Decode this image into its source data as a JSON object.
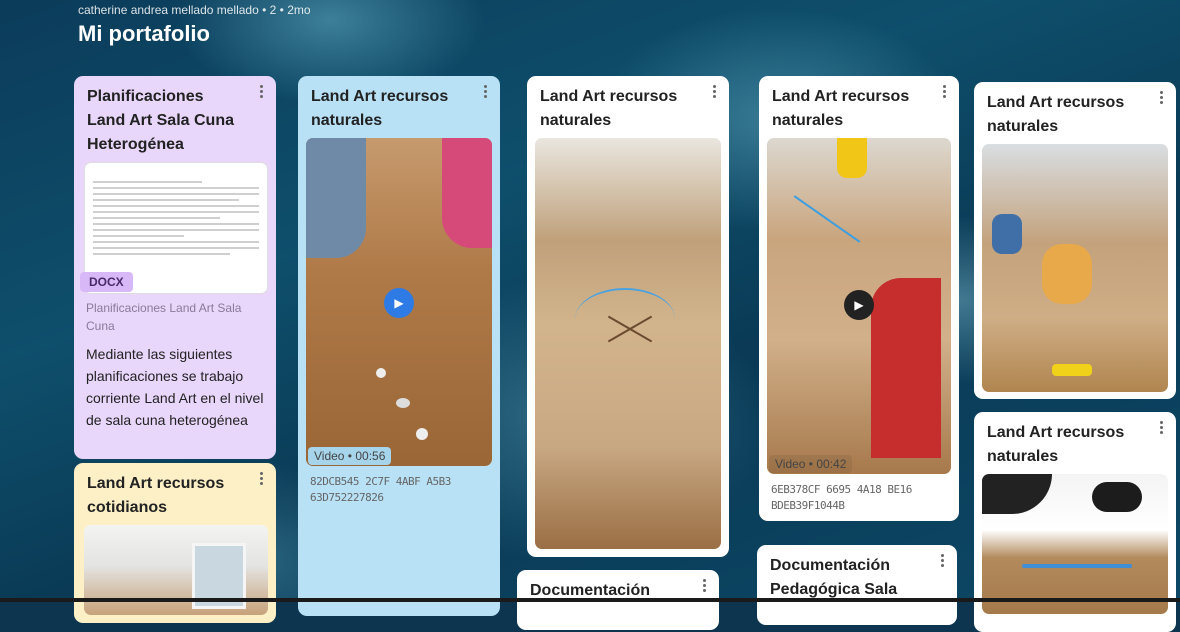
{
  "board": {
    "author_meta": "catherine andrea mellado mellado  • 2  • 2mo",
    "title": "Mi portafolio"
  },
  "colors": {
    "purple_card": "#e9d6fb",
    "blue_card": "#b8e1f5",
    "yellow_card": "#fdf0c6",
    "white_card": "#ffffff",
    "play_blue": "#2e7be6",
    "play_dark": "#222222"
  },
  "cards": [
    {
      "title": "Planificaciones Land Art Sala Cuna Heterogénea",
      "attachment_type": "DOCX",
      "attachment_name": "Planificaciones Land Art Sala Cuna",
      "description": "Mediante las siguientes planificaciones se trabajo corriente Land Art en el nivel de sala cuna heterogénea",
      "menu_icon": "more-vert-icon"
    },
    {
      "title": "Land Art recursos naturales",
      "video_label": "Video • 00:56",
      "file_id": "82DCB545 2C7F 4ABF A5B3 63D752227826",
      "play_icon": "play-icon"
    },
    {
      "title": "Land Art recursos naturales"
    },
    {
      "title": "Land Art recursos naturales",
      "video_label": "Video • 00:42",
      "file_id": "6EB378CF 6695 4A18 BE16 BDEB39F1044B",
      "play_icon": "play-icon"
    },
    {
      "title": "Land Art recursos naturales"
    },
    {
      "title": "Land Art recursos naturales"
    },
    {
      "title": "Land Art recursos cotidianos"
    },
    {
      "title": "Documentación"
    },
    {
      "title": "Documentación Pedagógica Sala"
    }
  ]
}
